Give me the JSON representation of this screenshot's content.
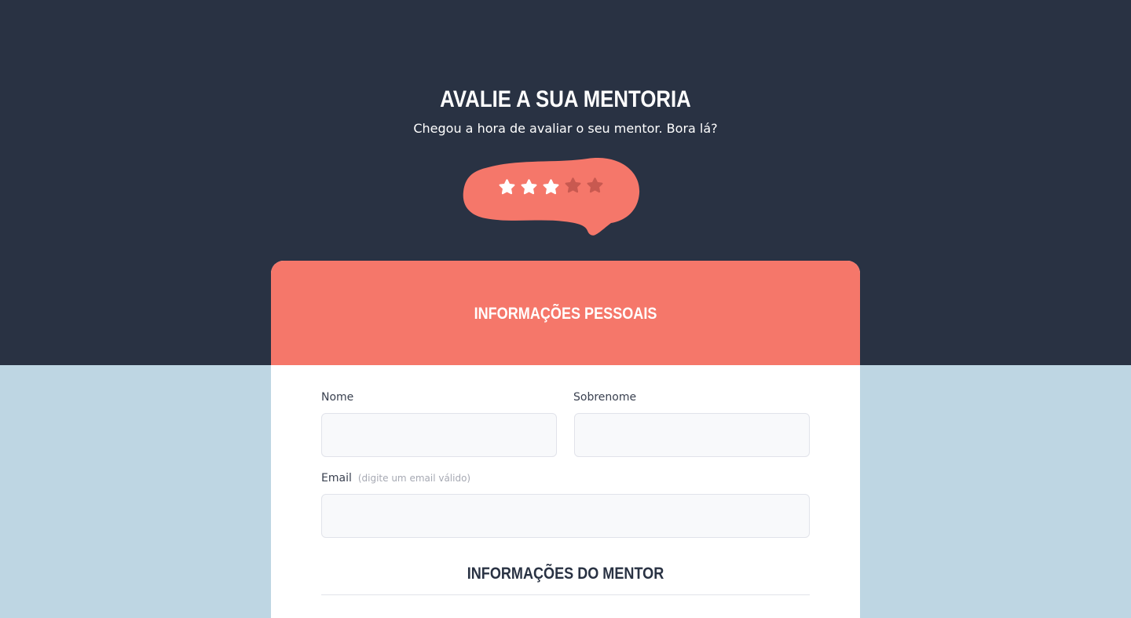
{
  "hero": {
    "title": "AVALIE A SUA MENTORIA",
    "subtitle": "Chegou a hora de avaliar o seu mentor. Bora lá?"
  },
  "rating": {
    "value": 3,
    "max": 5,
    "star_icon": "star-icon",
    "active_color": "#ffffff",
    "inactive_color": "#c85950",
    "bubble_color": "#f5776a"
  },
  "card": {
    "header_title": "INFORMAÇÕES PESSOAIS",
    "fields": {
      "first_name": {
        "label": "Nome",
        "value": "",
        "placeholder": ""
      },
      "last_name": {
        "label": "Sobrenome",
        "value": "",
        "placeholder": ""
      },
      "email": {
        "label": "Email",
        "hint": "(digite um email válido)",
        "value": "",
        "placeholder": ""
      }
    },
    "mentor_section_title": "INFORMAÇÕES DO MENTOR"
  },
  "colors": {
    "hero_bg": "#293243",
    "page_bg": "#bed6e3",
    "accent": "#f5776a",
    "heading_dark": "#293243"
  }
}
